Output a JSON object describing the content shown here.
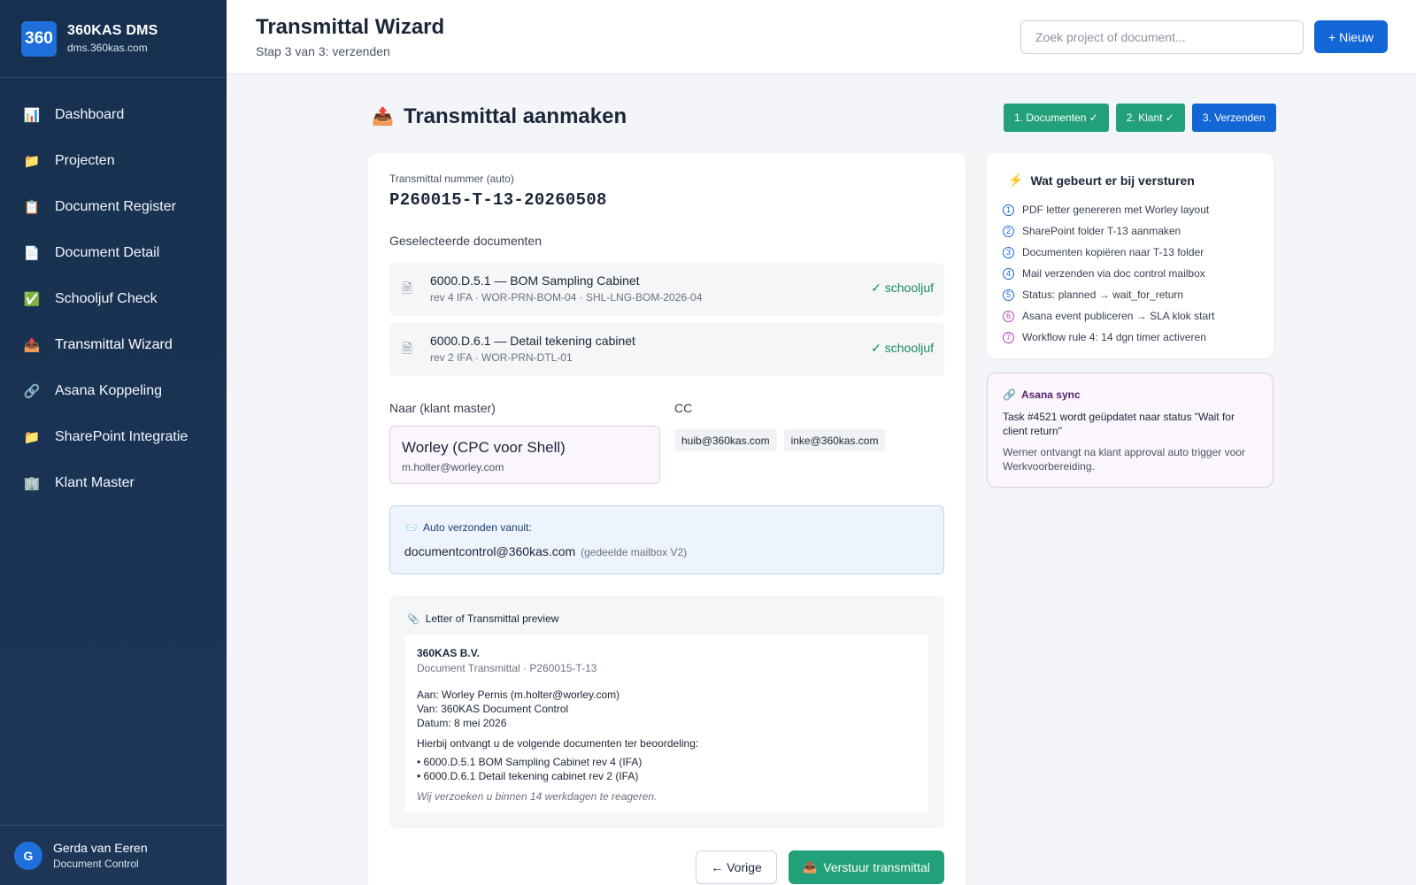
{
  "brand": {
    "logo": "360",
    "name": "360KAS DMS",
    "url": "dms.360kas.com"
  },
  "nav": [
    {
      "label": "Dashboard",
      "icon": "📊"
    },
    {
      "label": "Projecten",
      "icon": "📁"
    },
    {
      "label": "Document Register",
      "icon": "📋"
    },
    {
      "label": "Document Detail",
      "icon": "📄"
    },
    {
      "label": "Schooljuf Check",
      "icon": "✅"
    },
    {
      "label": "Transmittal Wizard",
      "icon": "📤"
    },
    {
      "label": "Asana Koppeling",
      "icon": "🔗"
    },
    {
      "label": "SharePoint Integratie",
      "icon": "📁"
    },
    {
      "label": "Klant Master",
      "icon": "🏢"
    }
  ],
  "user": {
    "initial": "G",
    "name": "Gerda van Eeren",
    "role": "Document Control"
  },
  "header": {
    "title": "Transmittal Wizard",
    "subtitle": "Stap 3 van 3: verzenden",
    "search_placeholder": "Zoek project of document...",
    "new_button": "+ Nieuw"
  },
  "wizard": {
    "icon": "📤",
    "title": "Transmittal aanmaken",
    "steps": [
      {
        "label": "1. Documenten ✓",
        "state": "done"
      },
      {
        "label": "2. Klant ✓",
        "state": "done"
      },
      {
        "label": "3. Verzenden",
        "state": "current"
      }
    ]
  },
  "transmittal": {
    "number_label": "Transmittal nummer (auto)",
    "number": "P260015-T-13-20260508",
    "docs_label": "Geselecteerde documenten",
    "documents": [
      {
        "title": "6000.D.5.1 — BOM Sampling Cabinet",
        "meta": "rev 4 IFA · WOR-PRN-BOM-04 · SHL-LNG-BOM-2026-04",
        "check": "✓ schooljuf"
      },
      {
        "title": "6000.D.6.1 — Detail tekening cabinet",
        "meta": "rev 2 IFA · WOR-PRN-DTL-01",
        "check": "✓ schooljuf"
      }
    ],
    "to_label": "Naar (klant master)",
    "to_name": "Worley (CPC voor Shell)",
    "to_email": "m.holter@worley.com",
    "cc_label": "CC",
    "cc": [
      "huib@360kas.com",
      "inke@360kas.com"
    ],
    "auto_label": "Auto verzonden vanuit:",
    "auto_email": "documentcontrol@360kas.com",
    "auto_note": "(gedeelde mailbox V2)"
  },
  "letter": {
    "heading": "Letter of Transmittal preview",
    "company": "360KAS B.V.",
    "doc_line": "Document Transmittal · P260015-T-13",
    "to": "Aan: Worley Pernis (m.holter@worley.com)",
    "from": "Van: 360KAS Document Control",
    "date": "Datum: 8 mei 2026",
    "intro": "Hierbij ontvangt u de volgende documenten ter beoordeling:",
    "items": [
      "• 6000.D.5.1 BOM Sampling Cabinet rev 4 (IFA)",
      "• 6000.D.6.1 Detail tekening cabinet rev 2 (IFA)"
    ],
    "footer": "Wij verzoeken u binnen 14 werkdagen te reageren."
  },
  "actions": {
    "prev": "← Vorige",
    "send": "Verstuur transmittal",
    "send_icon": "📤"
  },
  "info": {
    "title": "Wat gebeurt er bij versturen",
    "items": [
      {
        "num": "1",
        "text": "PDF letter genereren met Worley layout",
        "color": "#1366d6"
      },
      {
        "num": "2",
        "text": "SharePoint folder T-13 aanmaken",
        "color": "#1366d6"
      },
      {
        "num": "3",
        "text": "Documenten kopiëren naar T-13 folder",
        "color": "#1366d6"
      },
      {
        "num": "4",
        "text": "Mail verzenden via doc control mailbox",
        "color": "#1366d6"
      },
      {
        "num": "5",
        "text": "Status: planned → wait_for_return",
        "color": "#1366d6"
      },
      {
        "num": "6",
        "text": "Asana event publiceren → SLA klok start",
        "color": "#b23fc4"
      },
      {
        "num": "7",
        "text": "Workflow rule 4: 14 dgn timer activeren",
        "color": "#b23fc4"
      }
    ]
  },
  "asana_sync": {
    "title": "Asana sync",
    "text": "Task #4521 wordt geüpdatet naar status \"Wait for client return\"",
    "sub": "Werner ontvangt na klant approval auto trigger voor Werkvoorbereiding."
  }
}
